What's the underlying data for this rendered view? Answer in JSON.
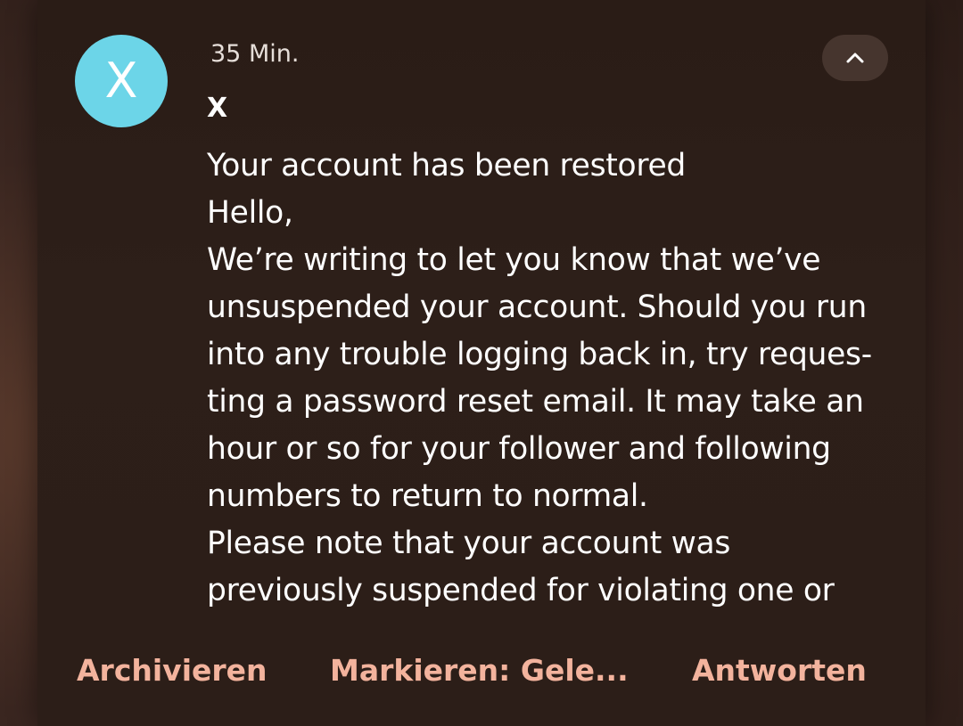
{
  "notification": {
    "avatar_letter": "X",
    "time": "35 Min.",
    "sender": "X",
    "collapse_icon": "chevron-up-icon",
    "body_lines": [
      "Your account has been restored",
      "Hello,",
      "We’re writing to let you know that we’ve",
      "unsuspended your account. Should you run",
      "into any trouble logging back in, try reques-",
      "ting a password reset email. It may take an",
      "hour or so for your follower and following",
      "numbers to return to normal.",
      "Please note that your account was",
      "previously suspended for violating one or"
    ]
  },
  "actions": {
    "archive": "Archivieren",
    "mark_read": "Markieren: Gele...",
    "reply": "Antworten"
  },
  "colors": {
    "avatar_bg": "#6cd5e8",
    "action_text": "#f3b39d",
    "card_bg": "#2c1e18"
  }
}
